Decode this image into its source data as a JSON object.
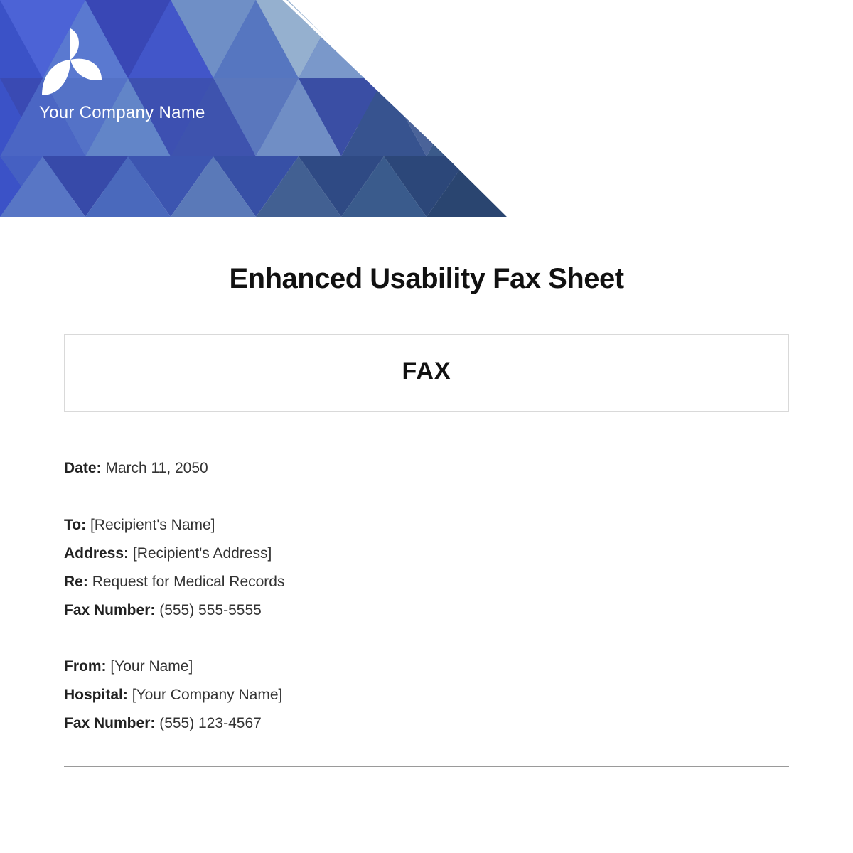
{
  "header": {
    "company_name": "Your Company Name"
  },
  "document": {
    "title": "Enhanced Usability Fax Sheet",
    "fax_box_label": "FAX"
  },
  "fields": {
    "date": {
      "label": "Date:",
      "value": "March 11, 2050"
    },
    "to": {
      "label": "To:",
      "value": "[Recipient's Name]"
    },
    "address": {
      "label": "Address:",
      "value": "[Recipient's Address]"
    },
    "re": {
      "label": "Re:",
      "value": "Request for Medical Records"
    },
    "fax_to": {
      "label": "Fax Number:",
      "value": "(555) 555-5555"
    },
    "from": {
      "label": "From:",
      "value": "[Your Name]"
    },
    "hospital": {
      "label": "Hospital:",
      "value": "[Your Company Name]"
    },
    "fax_from": {
      "label": "Fax Number:",
      "value": "(555) 123-4567"
    }
  }
}
